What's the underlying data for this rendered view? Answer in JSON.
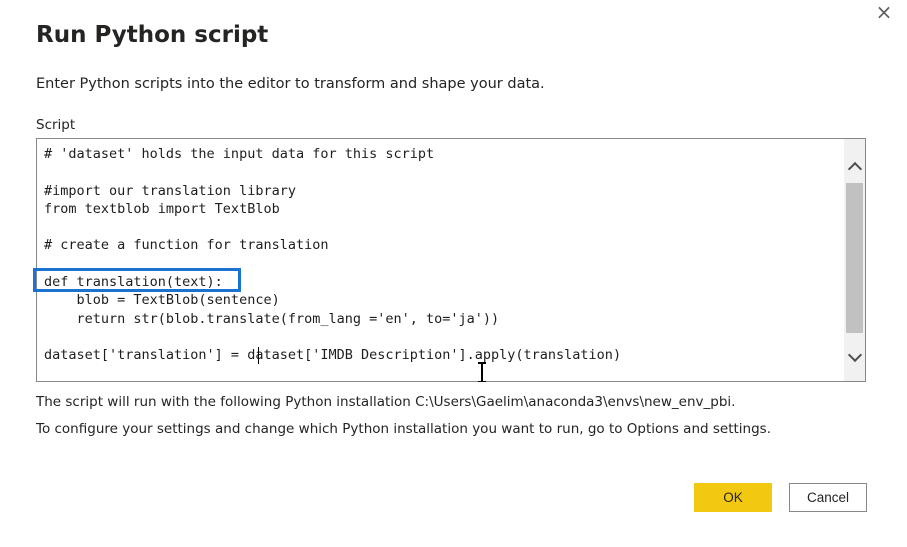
{
  "dialog": {
    "title": "Run Python script",
    "subtitle": "Enter Python scripts into the editor to transform and shape your data.",
    "close_icon": "×",
    "script_label": "Script"
  },
  "editor": {
    "lines": [
      "# 'dataset' holds the input data for this script",
      "",
      "#import our translation library",
      "from textblob import TextBlob",
      "",
      "# create a function for translation",
      "",
      "def translation(text):",
      "    blob = TextBlob(sentence)",
      "    return str(blob.translate(from_lang ='en', to='ja'))",
      "",
      "dataset['translation'] = dataset['IMDB Description'].apply(translation)"
    ]
  },
  "info": {
    "line1": "The script will run with the following Python installation C:\\Users\\Gaelim\\anaconda3\\envs\\new_env_pbi.",
    "line2": "To configure your settings and change which Python installation you want to run, go to Options and settings."
  },
  "buttons": {
    "ok": "OK",
    "cancel": "Cancel"
  },
  "colors": {
    "accent": "#f2c811",
    "highlight": "#1a73d1"
  }
}
